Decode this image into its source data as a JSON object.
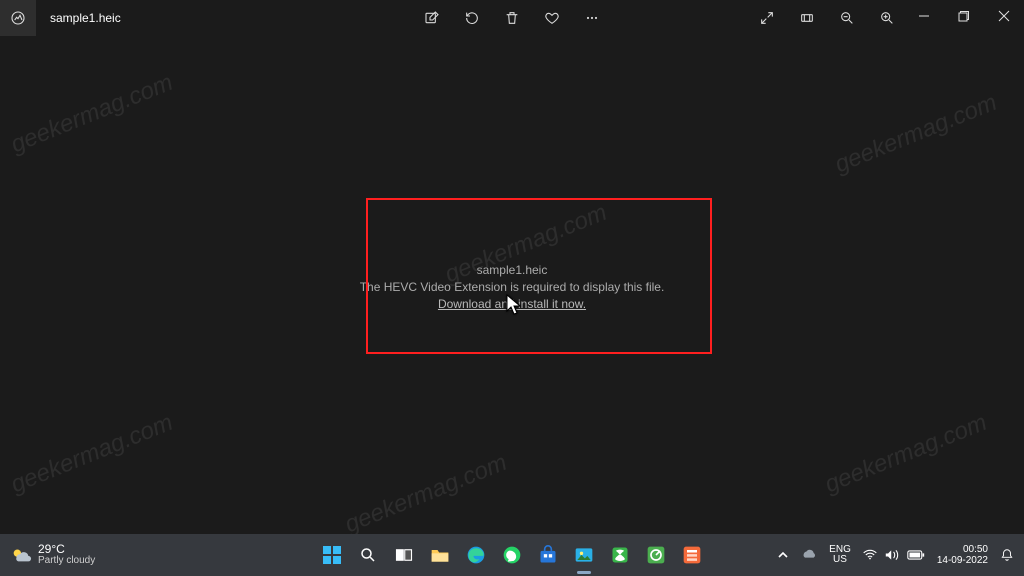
{
  "app": {
    "title": "sample1.heic",
    "toolbar": {
      "edit": "Edit",
      "rotate": "Rotate",
      "delete": "Delete",
      "favorite": "Favorite",
      "more": "More",
      "fullscreen": "Fullscreen",
      "filmstrip": "Filmstrip",
      "zoom_out": "Zoom out",
      "zoom_in": "Zoom in"
    },
    "window": {
      "minimize": "Minimize",
      "maximize": "Restore",
      "close": "Close"
    }
  },
  "message": {
    "filename": "sample1.heic",
    "info": "The HEVC Video Extension is required to display this file.",
    "link": "Download and install it now."
  },
  "taskbar": {
    "weather_temp": "29°C",
    "weather_cond": "Partly cloudy",
    "apps": [
      "Start",
      "Search",
      "Task View",
      "File Explorer",
      "Edge",
      "WhatsApp",
      "Microsoft Store",
      "Photos",
      "Xbox",
      "Camtasia",
      "App"
    ],
    "tray": {
      "chevron": "Show hidden icons",
      "lang_top": "ENG",
      "lang_bottom": "US",
      "time": "00:50",
      "date": "14-09-2022"
    }
  },
  "watermark": "geekermag.com"
}
